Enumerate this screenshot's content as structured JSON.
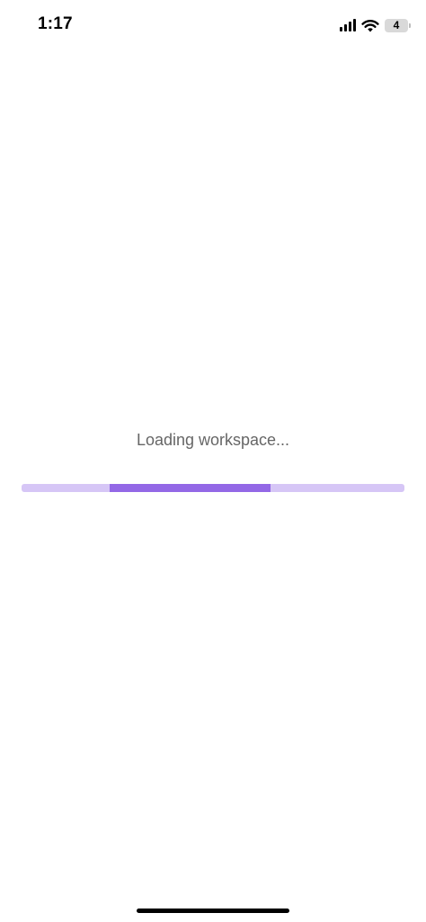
{
  "status_bar": {
    "time": "1:17",
    "battery_level": "4",
    "icons": [
      "cellular-signal-icon",
      "wifi-icon",
      "battery-icon"
    ]
  },
  "loading": {
    "message": "Loading workspace...",
    "progress_segment_start": 0.23,
    "progress_segment_end": 0.65,
    "colors": {
      "track": "#d6c6f6",
      "fill": "#9368e6"
    }
  }
}
